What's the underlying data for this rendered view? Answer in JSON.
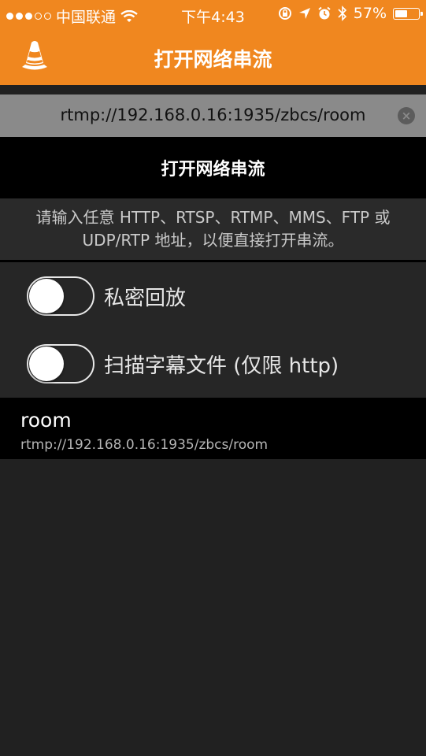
{
  "status_bar": {
    "signal_dots": 5,
    "signal_filled": 3,
    "carrier": "中国联通",
    "time": "下午4:43",
    "battery_text": "57%",
    "battery_level": 0.57
  },
  "header": {
    "title": "打开网络串流",
    "accent_color": "#f0871f"
  },
  "url_field": {
    "value": "rtmp://192.168.0.16:1935/zbcs/room",
    "clear_icon": "×"
  },
  "open_button": {
    "label": "打开网络串流"
  },
  "hint": {
    "line1": "请输入任意 HTTP、RTSP、RTMP、MMS、FTP 或",
    "line2": "UDP/RTP 地址，以便直接打开串流。"
  },
  "options": {
    "private_playback": {
      "label": "私密回放",
      "on": false
    },
    "scan_subtitles": {
      "label": "扫描字幕文件 (仅限 http)",
      "on": false
    }
  },
  "history": [
    {
      "name": "room",
      "url": "rtmp://192.168.0.16:1935/zbcs/room"
    }
  ]
}
